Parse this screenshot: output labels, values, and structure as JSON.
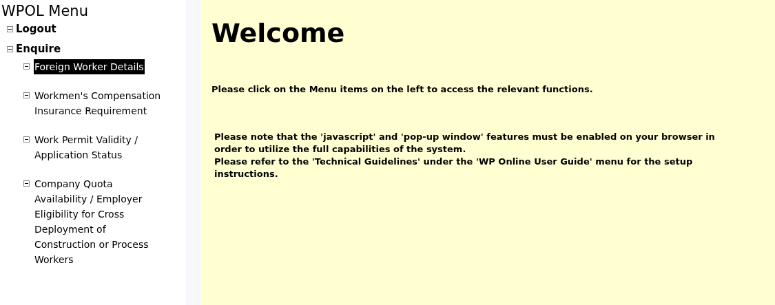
{
  "sidebar": {
    "title": "WPOL Menu",
    "items": [
      {
        "label": "Logout",
        "expanded": true,
        "selected": false
      },
      {
        "label": "Enquire",
        "expanded": true,
        "selected": false,
        "children": [
          {
            "label": "Foreign Worker Details",
            "expanded": true,
            "selected": true
          },
          {
            "label": "Workmen's Compensation Insurance Requirement",
            "expanded": true,
            "selected": false
          },
          {
            "label": "Work Permit Validity / Application Status",
            "expanded": true,
            "selected": false
          },
          {
            "label": "Company Quota Availability / Employer Eligibility for Cross Deployment of Construction or Process Workers",
            "expanded": true,
            "selected": false
          }
        ]
      }
    ]
  },
  "main": {
    "heading": "Welcome",
    "intro": "Please click on the Menu items on the left to access the relevant functions.",
    "notes": [
      "Please note that the 'javascript' and 'pop-up window' features must be enabled on your browser in order to utilize the full capabilities of the system.",
      "Please refer to the 'Technical Guidelines' under the 'WP Online User Guide' menu for the setup instructions."
    ]
  }
}
